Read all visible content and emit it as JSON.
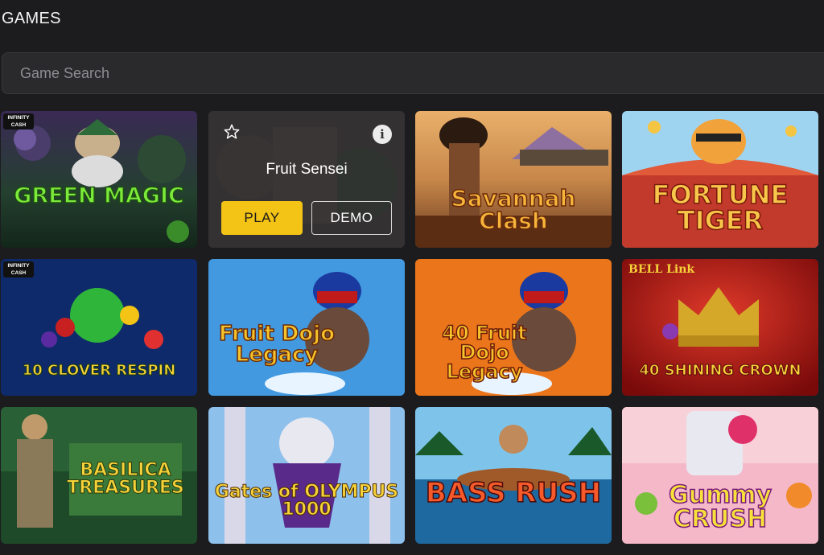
{
  "header": {
    "title": "GAMES"
  },
  "search": {
    "placeholder": "Game Search"
  },
  "games": [
    {
      "title": "GREEN MAGIC",
      "badge": "INFINITY CASH"
    },
    {
      "title": "Fruit Sensei",
      "play_label": "PLAY",
      "demo_label": "DEMO"
    },
    {
      "title": "Savannah Clash"
    },
    {
      "title": "FORTUNE TIGER"
    },
    {
      "title": "10 CLOVER RESPIN",
      "badge": "INFINITY CASH"
    },
    {
      "title": "Fruit Dojo Legacy"
    },
    {
      "title": "40 Fruit Dojo Legacy"
    },
    {
      "title": "40 SHINING CROWN",
      "extra": "BELL Link"
    },
    {
      "title": "BASILICA TREASURES"
    },
    {
      "title": "Gates of OLYMPUS 1000"
    },
    {
      "title": "BASS RUSH"
    },
    {
      "title": "Gummy CRUSH"
    }
  ],
  "colors": {
    "background": "#1c1c1e",
    "search_bg": "#2a2a2c",
    "play_button": "#f3c316"
  }
}
